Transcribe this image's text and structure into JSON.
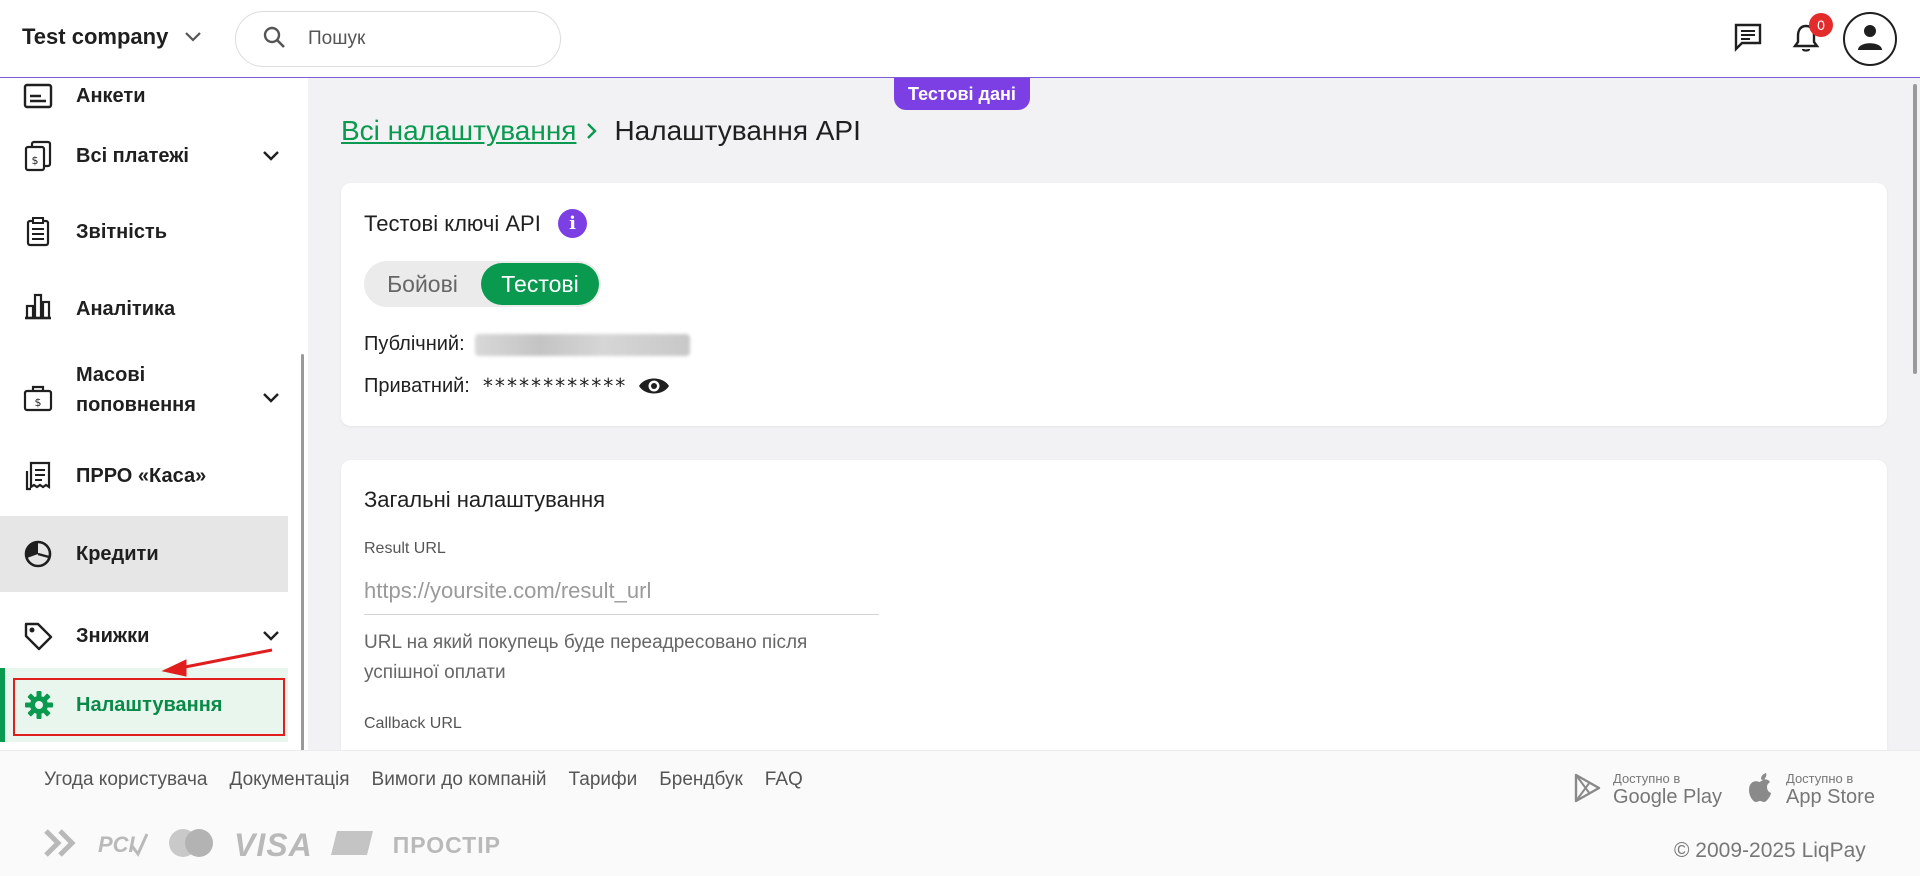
{
  "header": {
    "company": "Test company",
    "search_placeholder": "Пошук",
    "notifications_count": "0"
  },
  "test_badge": "Тестові дані",
  "sidebar": {
    "items": [
      {
        "label": "Анкети",
        "icon": "form-icon"
      },
      {
        "label": "Всі платежі",
        "icon": "payments-icon"
      },
      {
        "label": "Звітність",
        "icon": "reports-icon"
      },
      {
        "label": "Аналітика",
        "icon": "analytics-icon"
      },
      {
        "label": "Масові поповнення",
        "icon": "briefcase-icon"
      },
      {
        "label": "ПРРО «Каса»",
        "icon": "receipt-icon"
      },
      {
        "label": "Кредити",
        "icon": "credit-icon"
      },
      {
        "label": "Знижки",
        "icon": "tag-icon"
      },
      {
        "label": "Налаштування",
        "icon": "gear-icon"
      }
    ]
  },
  "breadcrumb": {
    "parent": "Всі налаштування",
    "current": "Налаштування API"
  },
  "api_keys": {
    "title": "Тестові ключі API",
    "toggle": {
      "live": "Бойові",
      "test": "Тестові",
      "selected": "Тестові"
    },
    "public_label": "Публічний:",
    "private_label": "Приватний:",
    "private_masked": "************"
  },
  "general": {
    "title": "Загальні налаштування",
    "result_url_label": "Result URL",
    "result_url_placeholder": "https://yoursite.com/result_url",
    "result_url_hint": "URL на який покупець буде переадресовано після успішної оплати",
    "callback_url_label": "Callback URL"
  },
  "footer": {
    "links": [
      "Угода користувача",
      "Документація",
      "Вимоги до компаній",
      "Тарифи",
      "Брендбук",
      "FAQ"
    ],
    "google_small": "Доступно в",
    "google_big": "Google Play",
    "apple_small": "Доступно в",
    "apple_big": "App Store",
    "copyright": "© 2009-2025 LiqPay",
    "payment_logos": {
      "visa": "VISA",
      "prostir": "ПРОСТІР",
      "pci": "PCI"
    }
  },
  "colors": {
    "accent_green": "#0a9a4f",
    "purple": "#7b3fe4",
    "badge_red": "#e32b2b",
    "annotation_red": "#e01e1e"
  }
}
